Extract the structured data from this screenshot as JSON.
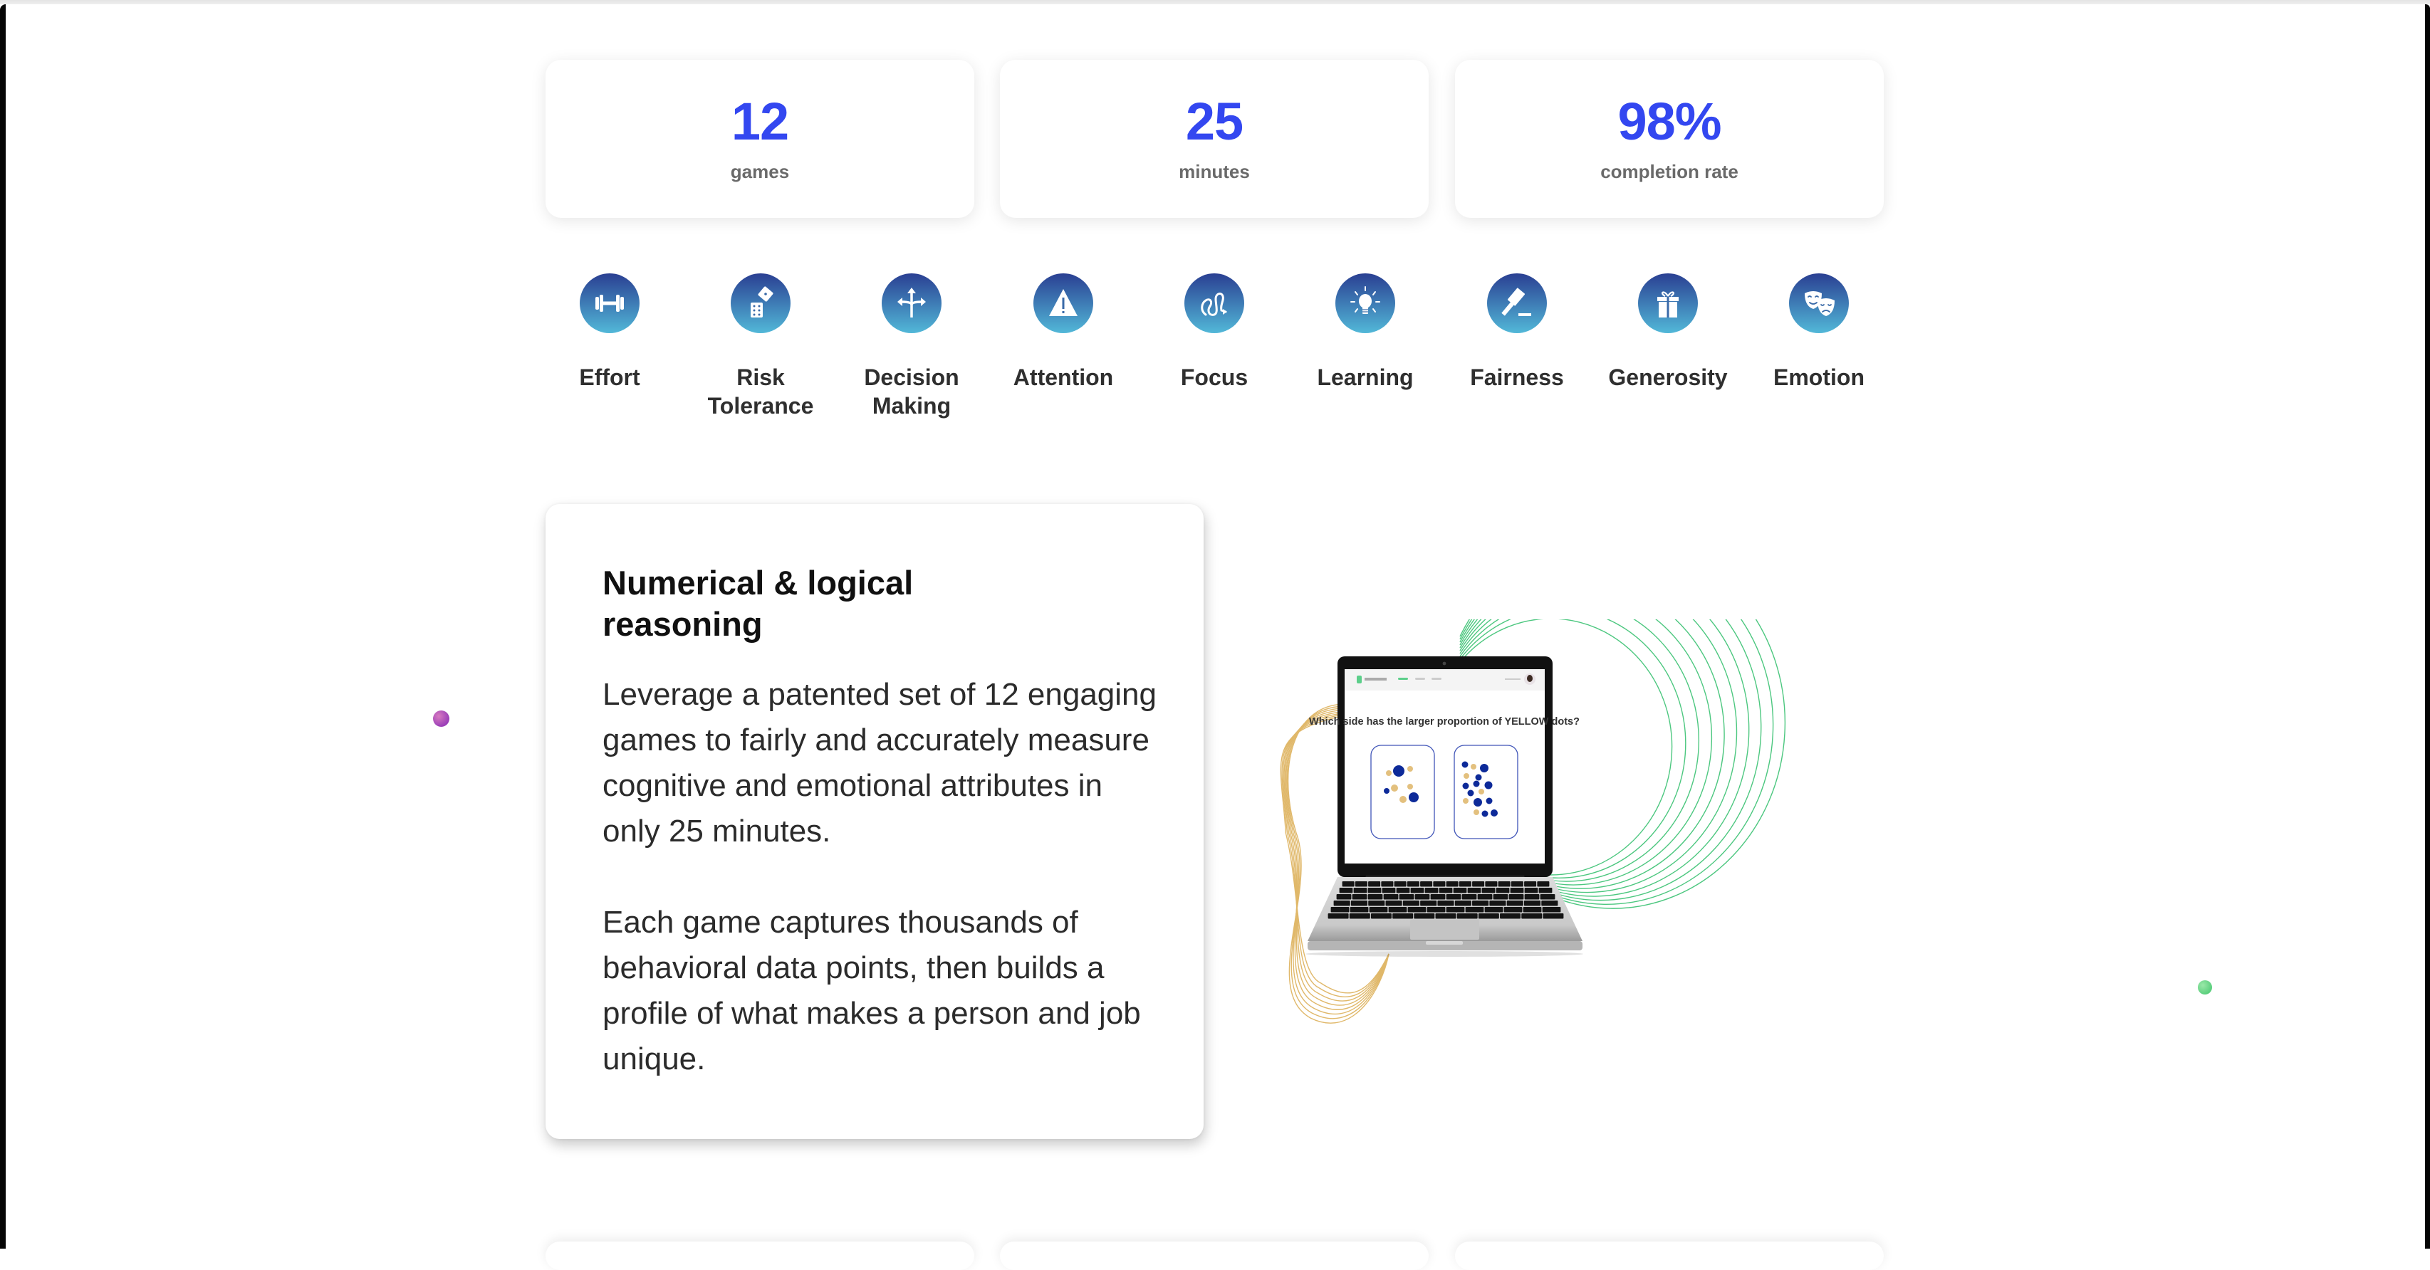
{
  "theme": {
    "accent_blue": "#3347f0",
    "icon_gradient_top": "#2a3f92",
    "icon_gradient_bottom": "#52b8d8",
    "label_gray": "#6a6a6a",
    "purple_dot": "#9b3fb8",
    "green_dot": "#5ccf7e",
    "ring_gold": "#e0b86a",
    "ring_green": "#4cc77f"
  },
  "stats": [
    {
      "value": "12",
      "label": "games"
    },
    {
      "value": "25",
      "label": "minutes"
    },
    {
      "value": "98%",
      "label": "completion rate"
    }
  ],
  "attributes": [
    {
      "label": "Effort",
      "icon": "dumbbell-icon"
    },
    {
      "label": "Risk Tolerance",
      "icon": "dice-icon"
    },
    {
      "label": "Decision Making",
      "icon": "split-arrows-icon"
    },
    {
      "label": "Attention",
      "icon": "warning-triangle-icon"
    },
    {
      "label": "Focus",
      "icon": "squiggle-path-icon"
    },
    {
      "label": "Learning",
      "icon": "lightbulb-icon"
    },
    {
      "label": "Fairness",
      "icon": "gavel-icon"
    },
    {
      "label": "Generosity",
      "icon": "gift-icon"
    },
    {
      "label": "Emotion",
      "icon": "theater-masks-icon"
    }
  ],
  "reasoning": {
    "title": "Numerical & logical reasoning",
    "paragraph1": "Leverage a patented set of 12 engaging games to fairly and accurately measure cognitive and emotional attributes in only 25 minutes.",
    "paragraph2": "Each game captures thousands of behavioral data points, then builds a profile of what makes a person and job unique."
  },
  "laptop_screen": {
    "question": "Which side has the larger proportion of YELLOW dots?",
    "left_panel": {
      "yellow_dots": 5,
      "blue_dots": 3
    },
    "right_panel": {
      "yellow_dots": 5,
      "blue_dots": 12
    }
  }
}
